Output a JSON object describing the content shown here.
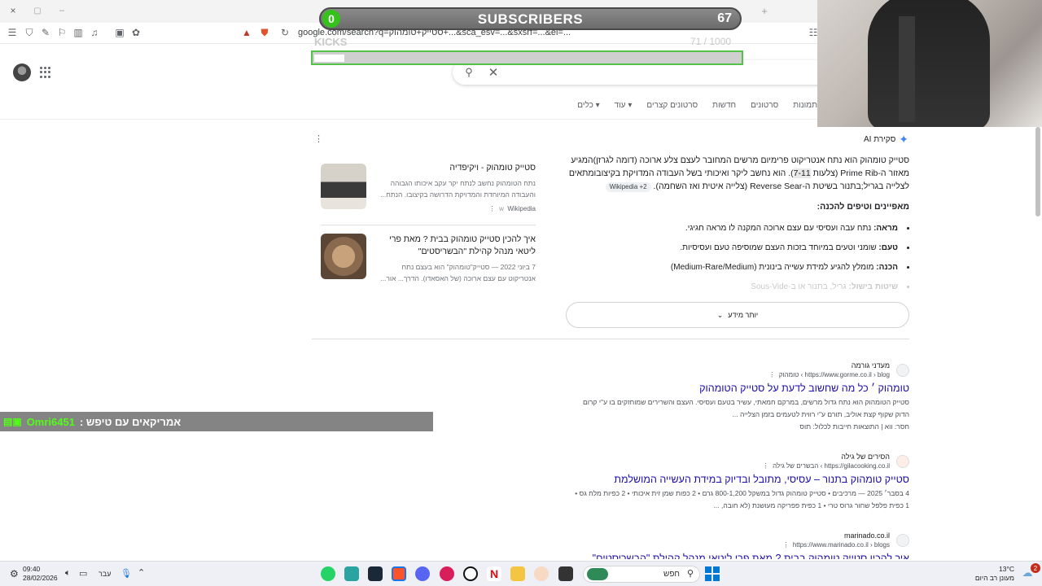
{
  "browser": {
    "url": "google.com/search?q=סטייק+טומהוק+...&sca_esv=...&sxsrf=...&ei=...",
    "tab_new": "+",
    "window_controls": [
      "×",
      "▢",
      "–"
    ]
  },
  "overlays": {
    "subscribers": {
      "count": "0",
      "title": "SUBSCRIBERS",
      "goal": "67"
    },
    "kicks": {
      "label": "KICKS",
      "goal": "71 / 1000",
      "progress_fraction": 0.071
    },
    "chat": {
      "user": "Omri6451",
      "message": "אמריקאים עם טיפש :"
    }
  },
  "google": {
    "tabs": [
      "תמונות",
      "סרטונים",
      "חדשות",
      "סרטונים קצרים",
      "עוד",
      "כלים"
    ],
    "ai_overview": {
      "label": "סקירת AI",
      "paragraph_1": "סטייק טומהוק הוא נתח אנטריקוט פרימיום מרשים המחובר לעצם צלע ארוכה (דומה לגרזן)המגיע מאזור ה-Prime Rib (צלעות",
      "paragraph_hl": "7-11",
      "paragraph_2": "). הוא נחשב ליקר ואיכותי בשל העבודה המדויקת בקיצובומתאים לצלייה בגריל;בתנור בשיטת ה-Reverse Sear (צלייה איטית ואז השחמה).",
      "chip": "Wikipedia +2",
      "subheading": "מאפיינים וטיפים להכנה:",
      "bullets": [
        {
          "term": "מראה:",
          "text": " נתח עבה ועסיסי עם עצם ארוכה המקנה לו מראה חגיגי."
        },
        {
          "term": "טעם:",
          "text": " שומני וטעים במיוחד בזכות העצם שמוסיפה טעם ועסיסיות."
        },
        {
          "term": "הכנה:",
          "text": " מומלץ להגיע למידת עשייה בינונית (Medium-Rare/Medium)"
        },
        {
          "term": "שיטות בישול:",
          "text": " גריל, בתנור או ב-Sous-Vide"
        }
      ],
      "more_label": "יותר מידע"
    },
    "cards": [
      {
        "title": "סטייק טומהוק - ויקיפדיה",
        "snippet": "נתח הטומהוק נחשב לנתח יקר עקב איכותו הגבוהה והעבודה המיוחדת והמדויקת הדרושה בקיצובו. הנתח...",
        "source": "Wikipedia"
      },
      {
        "title": "איך להכין סטייק טומהוק בבית ? מאת פרי ליטאי מנהל קהילת \"הבשריסטים\"",
        "snippet": "7 ביוני 2022 — סטייק\"טומהוק\" הוא בעצם נתח אנטריקוט עם עצם ארוכה (של האסאדו). הדרך... אור...",
        "source": ""
      }
    ],
    "results": [
      {
        "site": "מעדני גורמה",
        "crumb": "https://www.gorme.co.il › blog › טומהוק",
        "title": "טומהוק ׳ כל מה שחשוב לדעת על סטייק הטומהוק",
        "desc_1": "סטייק הטומהוק הוא נתח גדול מרשים, במרקם חמאתי, עשיר בטעם ועסיסי. העצם והשרירים שמוחזקים בו ע\"י קרום",
        "desc_2": "הדוק שקוף קצת אוליב, תורם ע\"י רווית לטעמים בזמן הצלייה ...",
        "desc_3": "חסר: ווא | התוצאות חייבות לכלול: תוס"
      },
      {
        "site": "הסירים של גילה",
        "crumb": "https://gilacooking.co.il › הבשרים של גילה",
        "title": "סטייק טומהוק בתנור – עסיסי, מתובל ובדיוק במידת העשייה המושלמת",
        "desc_1": "4 בסבר׳ 2025 — מרכיבים • סטייק טומהוק גדול במשקל 800-1,200 גרם • 2 כפות שמן זית איכותי • 2 כפיות מלח גס •",
        "desc_2": "1 כפית פלפל שחור גרוס טרי • 1 כפית פפריקה מעושנת (לא חובה, ...",
        "desc_3": ""
      },
      {
        "site": "marinado.co.il",
        "crumb": "https://www.marinado.co.il › blogs",
        "title": "איך להכין סטייק טומהוק בבית ? מאת פרי ליטאי מנהל קהילת \"הבשריסטים\"",
        "desc_1": "",
        "desc_2": "",
        "desc_3": ""
      }
    ]
  },
  "taskbar": {
    "time": "09:40",
    "date": "28/02/2026",
    "lang": "עבר",
    "search_placeholder": "חפש",
    "weather_temp": "13°C",
    "weather_desc": "מעונן רב היום",
    "notif_count": "2"
  },
  "colors": {
    "link": "#1a0dab",
    "kick_green": "#53fc18",
    "sub_green": "#34c21b"
  }
}
